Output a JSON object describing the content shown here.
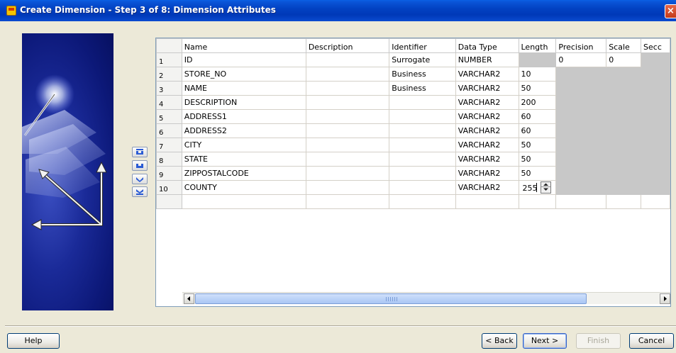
{
  "window": {
    "title": "Create Dimension - Step 3 of 8: Dimension Attributes",
    "close_label": "×"
  },
  "grid": {
    "columns": [
      "Name",
      "Description",
      "Identifier",
      "Data Type",
      "Length",
      "Precision",
      "Scale",
      "Secc"
    ],
    "rows": [
      {
        "num": "1",
        "name": "ID",
        "description": "",
        "identifier": "Surrogate",
        "data_type": "NUMBER",
        "length": "",
        "precision": "0",
        "scale": "0",
        "second": ""
      },
      {
        "num": "2",
        "name": "STORE_NO",
        "description": "",
        "identifier": "Business",
        "data_type": "VARCHAR2",
        "length": "10",
        "precision": "",
        "scale": "",
        "second": ""
      },
      {
        "num": "3",
        "name": "NAME",
        "description": "",
        "identifier": "Business",
        "data_type": "VARCHAR2",
        "length": "50",
        "precision": "",
        "scale": "",
        "second": ""
      },
      {
        "num": "4",
        "name": "DESCRIPTION",
        "description": "",
        "identifier": "",
        "data_type": "VARCHAR2",
        "length": "200",
        "precision": "",
        "scale": "",
        "second": ""
      },
      {
        "num": "5",
        "name": "ADDRESS1",
        "description": "",
        "identifier": "",
        "data_type": "VARCHAR2",
        "length": "60",
        "precision": "",
        "scale": "",
        "second": ""
      },
      {
        "num": "6",
        "name": "ADDRESS2",
        "description": "",
        "identifier": "",
        "data_type": "VARCHAR2",
        "length": "60",
        "precision": "",
        "scale": "",
        "second": ""
      },
      {
        "num": "7",
        "name": "CITY",
        "description": "",
        "identifier": "",
        "data_type": "VARCHAR2",
        "length": "50",
        "precision": "",
        "scale": "",
        "second": ""
      },
      {
        "num": "8",
        "name": "STATE",
        "description": "",
        "identifier": "",
        "data_type": "VARCHAR2",
        "length": "50",
        "precision": "",
        "scale": "",
        "second": ""
      },
      {
        "num": "9",
        "name": "ZIPPOSTALCODE",
        "description": "",
        "identifier": "",
        "data_type": "VARCHAR2",
        "length": "50",
        "precision": "",
        "scale": "",
        "second": ""
      },
      {
        "num": "10",
        "name": "COUNTY",
        "description": "",
        "identifier": "",
        "data_type": "VARCHAR2",
        "length": "255",
        "precision": "",
        "scale": "",
        "second": ""
      }
    ]
  },
  "reorder_buttons": [
    "move-to-top-icon",
    "move-up-icon",
    "move-down-icon",
    "move-to-bottom-icon"
  ],
  "buttons": {
    "help": "Help",
    "back": "< Back",
    "next": "Next >",
    "finish": "Finish",
    "cancel": "Cancel"
  },
  "colors": {
    "titlebar": "#0242c2",
    "disabled_cell": "#c8c8c8",
    "panel": "#1a2a98"
  }
}
